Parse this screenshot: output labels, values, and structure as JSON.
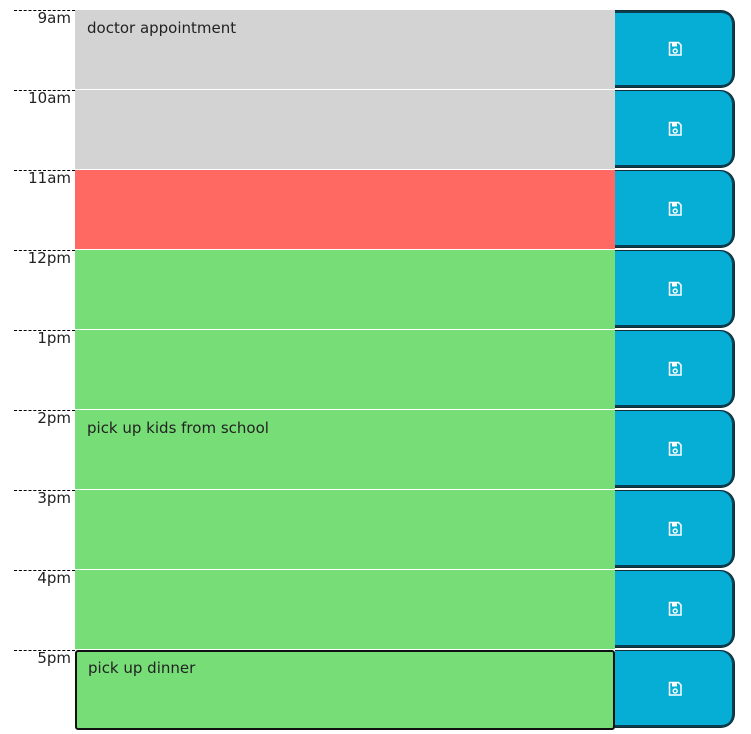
{
  "planner": {
    "rows": [
      {
        "hour": "9am",
        "text": "doctor appointment",
        "status": "past"
      },
      {
        "hour": "10am",
        "text": "",
        "status": "past"
      },
      {
        "hour": "11am",
        "text": "",
        "status": "present"
      },
      {
        "hour": "12pm",
        "text": "",
        "status": "future"
      },
      {
        "hour": "1pm",
        "text": "",
        "status": "future"
      },
      {
        "hour": "2pm",
        "text": "pick up kids from school",
        "status": "future"
      },
      {
        "hour": "3pm",
        "text": "",
        "status": "future"
      },
      {
        "hour": "4pm",
        "text": "",
        "status": "future"
      },
      {
        "hour": "5pm",
        "text": "pick up dinner",
        "status": "future"
      }
    ],
    "save_icon": "floppy-disk-icon",
    "colors": {
      "past": "#d3d3d3",
      "present": "#ff6961",
      "future": "#77dd77",
      "save_button": "#06aed5"
    }
  }
}
